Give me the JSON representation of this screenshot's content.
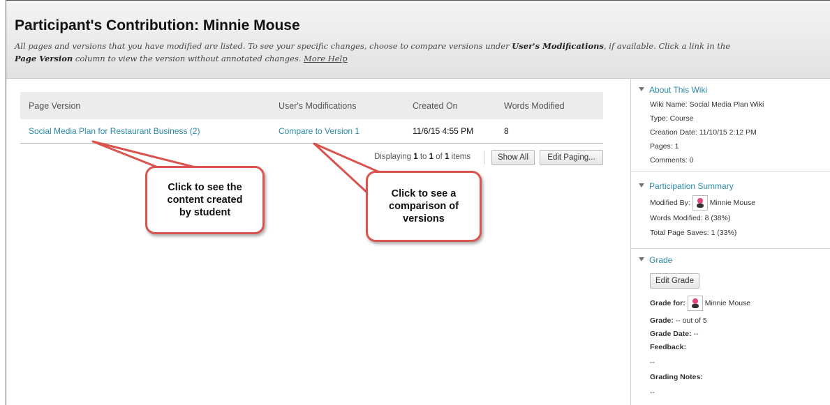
{
  "header": {
    "title": "Participant's Contribution: Minnie Mouse",
    "instructions_1": "All pages and versions that you have modified are listed. To see your specific changes, choose to compare versions under ",
    "instructions_bold_1": "User's Modifications",
    "instructions_2": ", if available. Click a link in the ",
    "instructions_bold_2": "Page Version",
    "instructions_3": " column to view the version without annotated changes. ",
    "more_help": "More Help"
  },
  "table": {
    "columns": [
      "Page Version",
      "User's Modifications",
      "Created On",
      "Words Modified"
    ],
    "rows": [
      {
        "page_version": "Social Media Plan for Restaurant Business (2)",
        "modifications": "Compare to Version 1",
        "created_on": "11/6/15 4:55 PM",
        "words_modified": "8"
      }
    ]
  },
  "paging": {
    "displaying": "Displaying ",
    "from": "1",
    "to_word": " to ",
    "to": "1",
    "of_word": " of ",
    "total": "1",
    "items_word": " items",
    "show_all": "Show All",
    "edit_paging": "Edit Paging..."
  },
  "callouts": {
    "left": "Click to see the content created by student",
    "right": "Click to see a comparison of versions"
  },
  "sidebar": {
    "about": {
      "title": "About This Wiki",
      "wiki_name": "Wiki Name: Social Media Plan Wiki",
      "type": "Type: Course",
      "creation_date": "Creation Date: 11/10/15 2:12 PM",
      "pages": "Pages: 1",
      "comments": "Comments: 0"
    },
    "participation": {
      "title": "Participation Summary",
      "modified_by_label": "Modified By:",
      "modified_by_name": "Minnie Mouse",
      "words_modified": "Words Modified: 8 (38%)",
      "page_saves": "Total Page Saves: 1 (33%)"
    },
    "grade": {
      "title": "Grade",
      "edit_grade": "Edit Grade",
      "grade_for_label": "Grade for:",
      "grade_for_name": "Minnie Mouse",
      "grade_label": "Grade:",
      "grade_value": "-- out of 5",
      "grade_date_label": "Grade Date:",
      "grade_date_value": "--",
      "feedback_label": "Feedback:",
      "feedback_value": "--",
      "notes_label": "Grading Notes:",
      "notes_value": "--"
    }
  },
  "colors": {
    "link": "#2a8aa6",
    "callout_border": "#d9534f"
  }
}
